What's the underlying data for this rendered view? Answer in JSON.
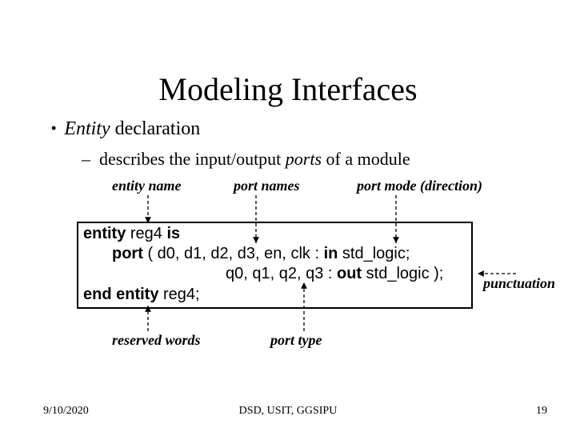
{
  "title": "Modeling Interfaces",
  "bullet1_pre": "Entity",
  "bullet1_post": " declaration",
  "bullet2_pre": "describes the input/output ",
  "bullet2_em": "ports",
  "bullet2_post": " of a module",
  "labels": {
    "entity_name": "entity name",
    "port_names": "port names",
    "port_mode": "port mode (direction)",
    "punctuation": "punctuation",
    "reserved_words": "reserved words",
    "port_type": "port type"
  },
  "code": {
    "l1_kw1": "entity",
    "l1_mid": " reg4 ",
    "l1_kw2": "is",
    "l2_kw": "port",
    "l2_rest": " ( d0, d1, d2, d3, en, clk : ",
    "l2_kw2": "in",
    "l2_tail": " std_logic;",
    "l3_rest": "q0, q1, q2, q3 : ",
    "l3_kw": "out",
    "l3_tail": " std_logic );",
    "l4_kw": "end entity",
    "l4_tail": " reg4;"
  },
  "footer": {
    "date": "9/10/2020",
    "center": "DSD, USIT, GGSIPU",
    "page": "19"
  }
}
